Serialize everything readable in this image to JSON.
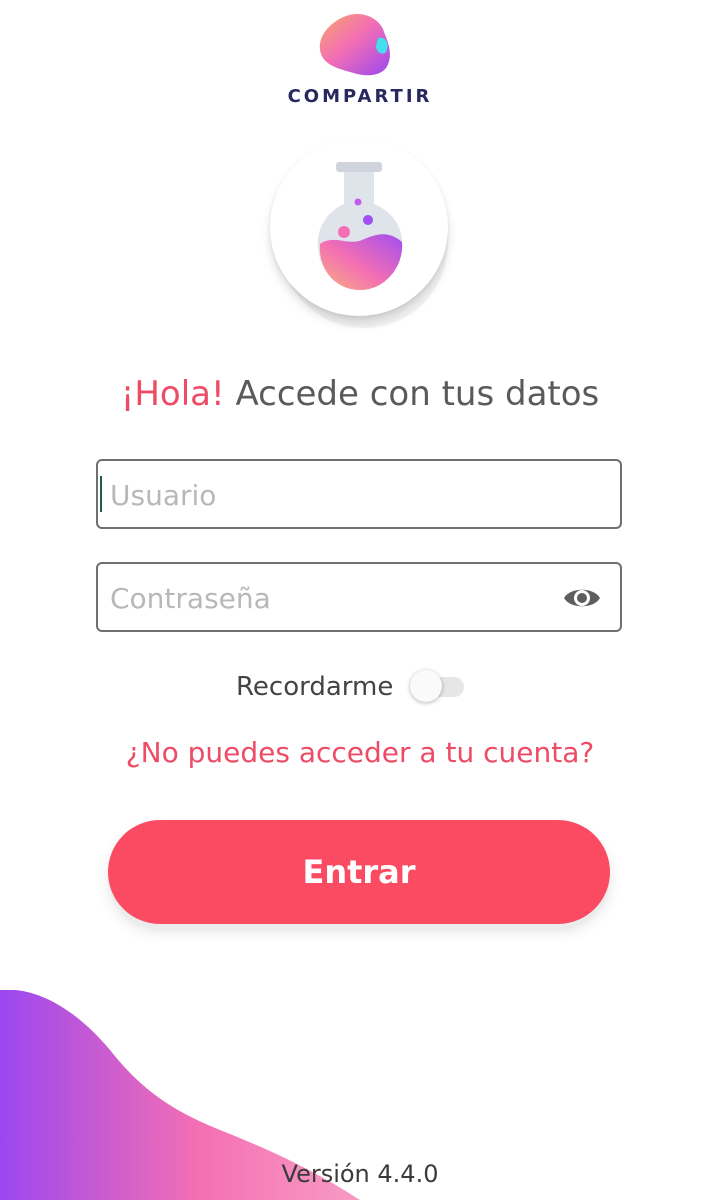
{
  "brand": {
    "name": "COMPARTIR",
    "logo_icon": "color-blob-logo-icon",
    "colors": {
      "primary": "#fb4b63",
      "accent_pink": "#ee4c66",
      "navy": "#26285e",
      "gradient_purple": "#9b47f0",
      "gradient_pink": "#f780b8",
      "gradient_cyan": "#42e0ef"
    }
  },
  "hero": {
    "icon": "flask-icon"
  },
  "greeting": {
    "highlight": "¡Hola!",
    "text": "Accede con tus datos"
  },
  "form": {
    "username": {
      "placeholder": "Usuario",
      "value": ""
    },
    "password": {
      "placeholder": "Contraseña",
      "value": "",
      "toggle_icon": "eye-icon"
    },
    "remember": {
      "label": "Recordarme",
      "checked": false
    },
    "forgot_link": "¿No puedes acceder a tu cuenta?",
    "submit_label": "Entrar"
  },
  "footer": {
    "version": "Versión 4.4.0"
  }
}
